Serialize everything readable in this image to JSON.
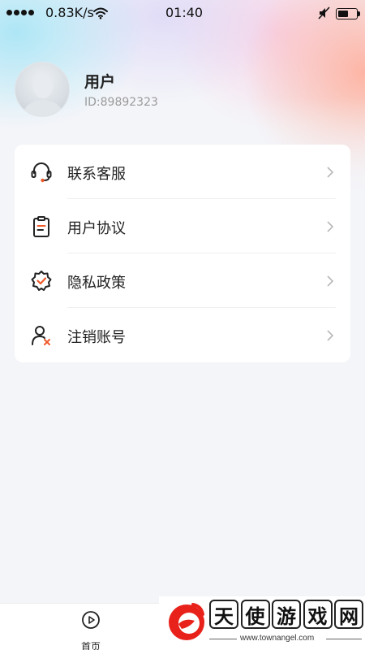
{
  "status_bar": {
    "network_speed": "0.83K/s",
    "time": "01:40",
    "icons": [
      "signal-dots-icon",
      "wifi-icon",
      "mute-icon",
      "battery-icon"
    ],
    "battery_level": 0.4
  },
  "profile": {
    "name": "用户",
    "id_text": "ID:89892323",
    "avatar_icon": "user-avatar-icon"
  },
  "menu": {
    "items": [
      {
        "label": "联系客服",
        "icon": "headset-icon"
      },
      {
        "label": "用户协议",
        "icon": "clipboard-icon"
      },
      {
        "label": "隐私政策",
        "icon": "shield-check-icon"
      },
      {
        "label": "注销账号",
        "icon": "user-remove-icon"
      }
    ]
  },
  "tabbar": {
    "home_label": "首页",
    "home_icon": "play-circle-icon"
  },
  "watermark": {
    "chars": [
      "天",
      "使",
      "游",
      "戏",
      "网"
    ],
    "url": "www.townangel.com"
  },
  "colors": {
    "accent": "#ef5a2a",
    "background": "#f4f5f9",
    "card": "#ffffff",
    "text_primary": "#222222",
    "text_secondary": "#9a9a9a"
  }
}
